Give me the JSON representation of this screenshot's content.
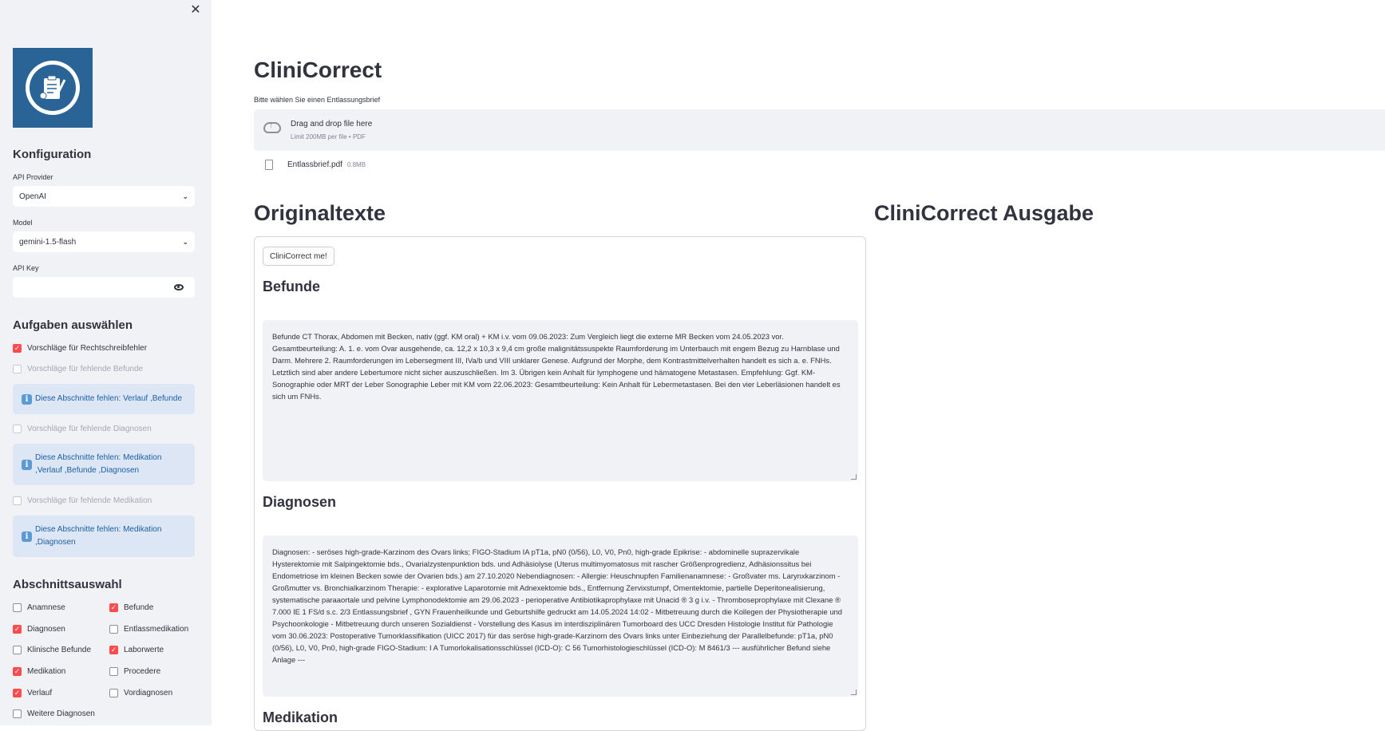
{
  "sidebar": {
    "close_label": "✕",
    "config_title": "Konfiguration",
    "provider_label": "API Provider",
    "provider_value": "OpenAI",
    "model_label": "Model",
    "model_value": "gemini-1.5-flash",
    "apikey_label": "API Key",
    "apikey_value": "",
    "tasks_title": "Aufgaben auswählen",
    "tasks": [
      {
        "label": "Vorschläge für Rechtschreibfehler",
        "checked": true,
        "disabled": false
      },
      {
        "label": "Vorschläge für fehlende Befunde",
        "checked": false,
        "disabled": true
      },
      {
        "label": "Vorschläge für fehlende Diagnosen",
        "checked": false,
        "disabled": true
      },
      {
        "label": "Vorschläge für fehlende Medikation",
        "checked": false,
        "disabled": true
      }
    ],
    "infos": [
      "Diese Abschnitte fehlen: Verlauf ,Befunde",
      "Diese Abschnitte fehlen: Medikation ,Verlauf ,Befunde ,Diagnosen",
      "Diese Abschnitte fehlen: Medikation ,Diagnosen"
    ],
    "info_icon": "i",
    "sections_title": "Abschnittsauswahl",
    "sections": [
      {
        "label": "Anamnese",
        "checked": false
      },
      {
        "label": "Befunde",
        "checked": true
      },
      {
        "label": "Diagnosen",
        "checked": true
      },
      {
        "label": "Entlassmedikation",
        "checked": false
      },
      {
        "label": "Klinische Befunde",
        "checked": false
      },
      {
        "label": "Laborwerte",
        "checked": true
      },
      {
        "label": "Medikation",
        "checked": true
      },
      {
        "label": "Procedere",
        "checked": false
      },
      {
        "label": "Verlauf",
        "checked": true
      },
      {
        "label": "Vordiagnosen",
        "checked": false
      },
      {
        "label": "Weitere Diagnosen",
        "checked": false
      }
    ]
  },
  "main": {
    "title": "CliniCorrect",
    "uploader_label": "Bitte wählen Sie einen Entlassungsbrief",
    "dropzone_title": "Drag and drop file here",
    "dropzone_sub": "Limit 200MB per file • PDF",
    "file_name": "Entlassbrief.pdf",
    "file_size": "0.8MB",
    "original_title": "Originaltexte",
    "output_title": "CliniCorrect Ausgabe",
    "button_label": "CliniCorrect me!",
    "section_befunde": "Befunde",
    "befunde_text": "Befunde CT Thorax, Abdomen mit Becken, nativ (ggf. KM oral) + KM i.v. vom 09.06.2023: Zum Vergleich liegt die externe MR Becken vom 24.05.2023 vor. Gesamtbeurteilung: A. 1. e. vom Ovar ausgehende, ca. 12,2 x 10,3 x 9,4 cm große malignitätssuspekte Raumforderung im Unterbauch mit engem Bezug zu Harnblase und Darm. Mehrere 2. Raumforderungen im Lebersegment III, IVa/b und VIII unklarer Genese. Aufgrund der Morphe, dem Kontrastmittelverhalten handelt es sich a. e. FNHs. Letztlich sind aber andere Lebertumore nicht sicher auszuschließen. Im 3. Übrigen kein Anhalt für lymphogene und hämatogene Metastasen. Empfehlung: Ggf. KM-Sonographie oder MRT der Leber Sonographie Leber mit KM vom 22.06.2023: Gesamtbeurteilung: Kein Anhalt für Lebermetastasen. Bei den vier Leberläsionen handelt es sich um FNHs.",
    "section_diagnosen": "Diagnosen",
    "diagnosen_text": "Diagnosen: - seröses high-grade-Karzinom des Ovars links; FIGO-Stadium IA pT1a, pN0 (0/56), L0, V0, Pn0, high-grade Epikrise: - abdominelle suprazervikale Hysterektomie mit Salpingektomie bds., Ovarialzystenpunktion bds. und Adhäsiolyse (Uterus multimyomatosus mit rascher Größenprogredienz, Adhäsionssitus bei Endometriose im kleinen Becken sowie der Ovarien bds.) am 27.10.2020 Nebendiagnosen: - Allergie: Heuschnupfen Familienanamnese: - Großvater ms. Larynxkarzinom - Großmutter vs. Bronchialkarzinom Therapie: - explorative Laparotomie mit Adnexektomie bds., Entfernung Zervixstumpf, Omentektomie, partielle Deperitonealisierung, systematische paraaortale und pelvine Lymphonodektomie am 29.06.2023 - perioperative Antibiotikaprophylaxe mit Unacid ® 3 g i.v. - Thromboseprophylaxe mit Clexane ® 7.000 IE 1 FS/d s.c. 2/3 Entlassungsbrief , GYN Frauenheilkunde und Geburtshilfe gedruckt am 14.05.2024 14:02 - Mitbetreuung durch die Kollegen der Physiotherapie und Psychoonkologie - Mitbetreuung durch unseren Sozialdienst - Vorstellung des Kasus im interdisziplinären Tumorboard des UCC Dresden Histologie Institut für Pathologie vom 30.06.2023: Postoperative Tumorklassifikation (UICC 2017) für das seröse high-grade-Karzinom des Ovars links unter Einbeziehung der Parallelbefunde: pT1a, pN0 (0/56), L0, V0, Pn0, high-grade FIGO-Stadium: I A Tumorlokalisationsschlüssel (ICD-O): C 56 Tumorhistologieschlüssel (ICD-O): M 8461/3 --- ausführlicher Befund siehe Anlage ---",
    "section_medikation": "Medikation"
  }
}
